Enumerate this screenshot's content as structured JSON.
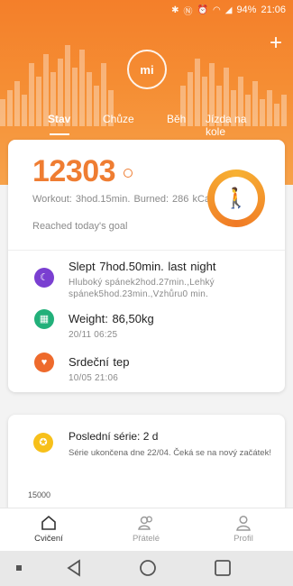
{
  "status_bar": {
    "battery": "94%",
    "time": "21:06"
  },
  "colors": {
    "accent": "#ef7d32",
    "sleep": "#7a3fd1",
    "weight": "#22b07a",
    "heart": "#ee6a2c",
    "series": "#f7c01a"
  },
  "header": {
    "logo_text": "mi",
    "add_label": "+",
    "tabs": [
      {
        "label": "Stav",
        "active": true
      },
      {
        "label": "Chůze"
      },
      {
        "label": "Běh"
      },
      {
        "label": "Jízda na kole"
      }
    ]
  },
  "summary": {
    "steps": "12303",
    "workout": "Workout: 3hod.15min. Burned: 286 kCal",
    "goal": "Reached today's goal"
  },
  "rows": {
    "sleep": {
      "title": "Slept 7hod.50min. last night",
      "detail": "Hluboký spánek2hod.27min.,Lehký spánek5hod.23min.,Vzhůru0 min."
    },
    "weight": {
      "title": "Weight: 86,50kg",
      "detail": "20/11 06:25"
    },
    "heart": {
      "title": "Srdeční tep",
      "detail": "10/05 21:06"
    }
  },
  "series": {
    "title": "Poslední série: 2 d",
    "detail": "Série ukončena dne 22/04. Čeká se na nový začátek!",
    "axis_tick": "15000"
  },
  "bottom_nav": [
    {
      "label": "Cvičení",
      "icon": "home-icon",
      "active": true
    },
    {
      "label": "Přátelé",
      "icon": "friends-icon"
    },
    {
      "label": "Profil",
      "icon": "profile-icon"
    }
  ],
  "system_nav": [
    "square-dot-icon",
    "back-icon",
    "home-circle-icon",
    "recents-icon"
  ]
}
